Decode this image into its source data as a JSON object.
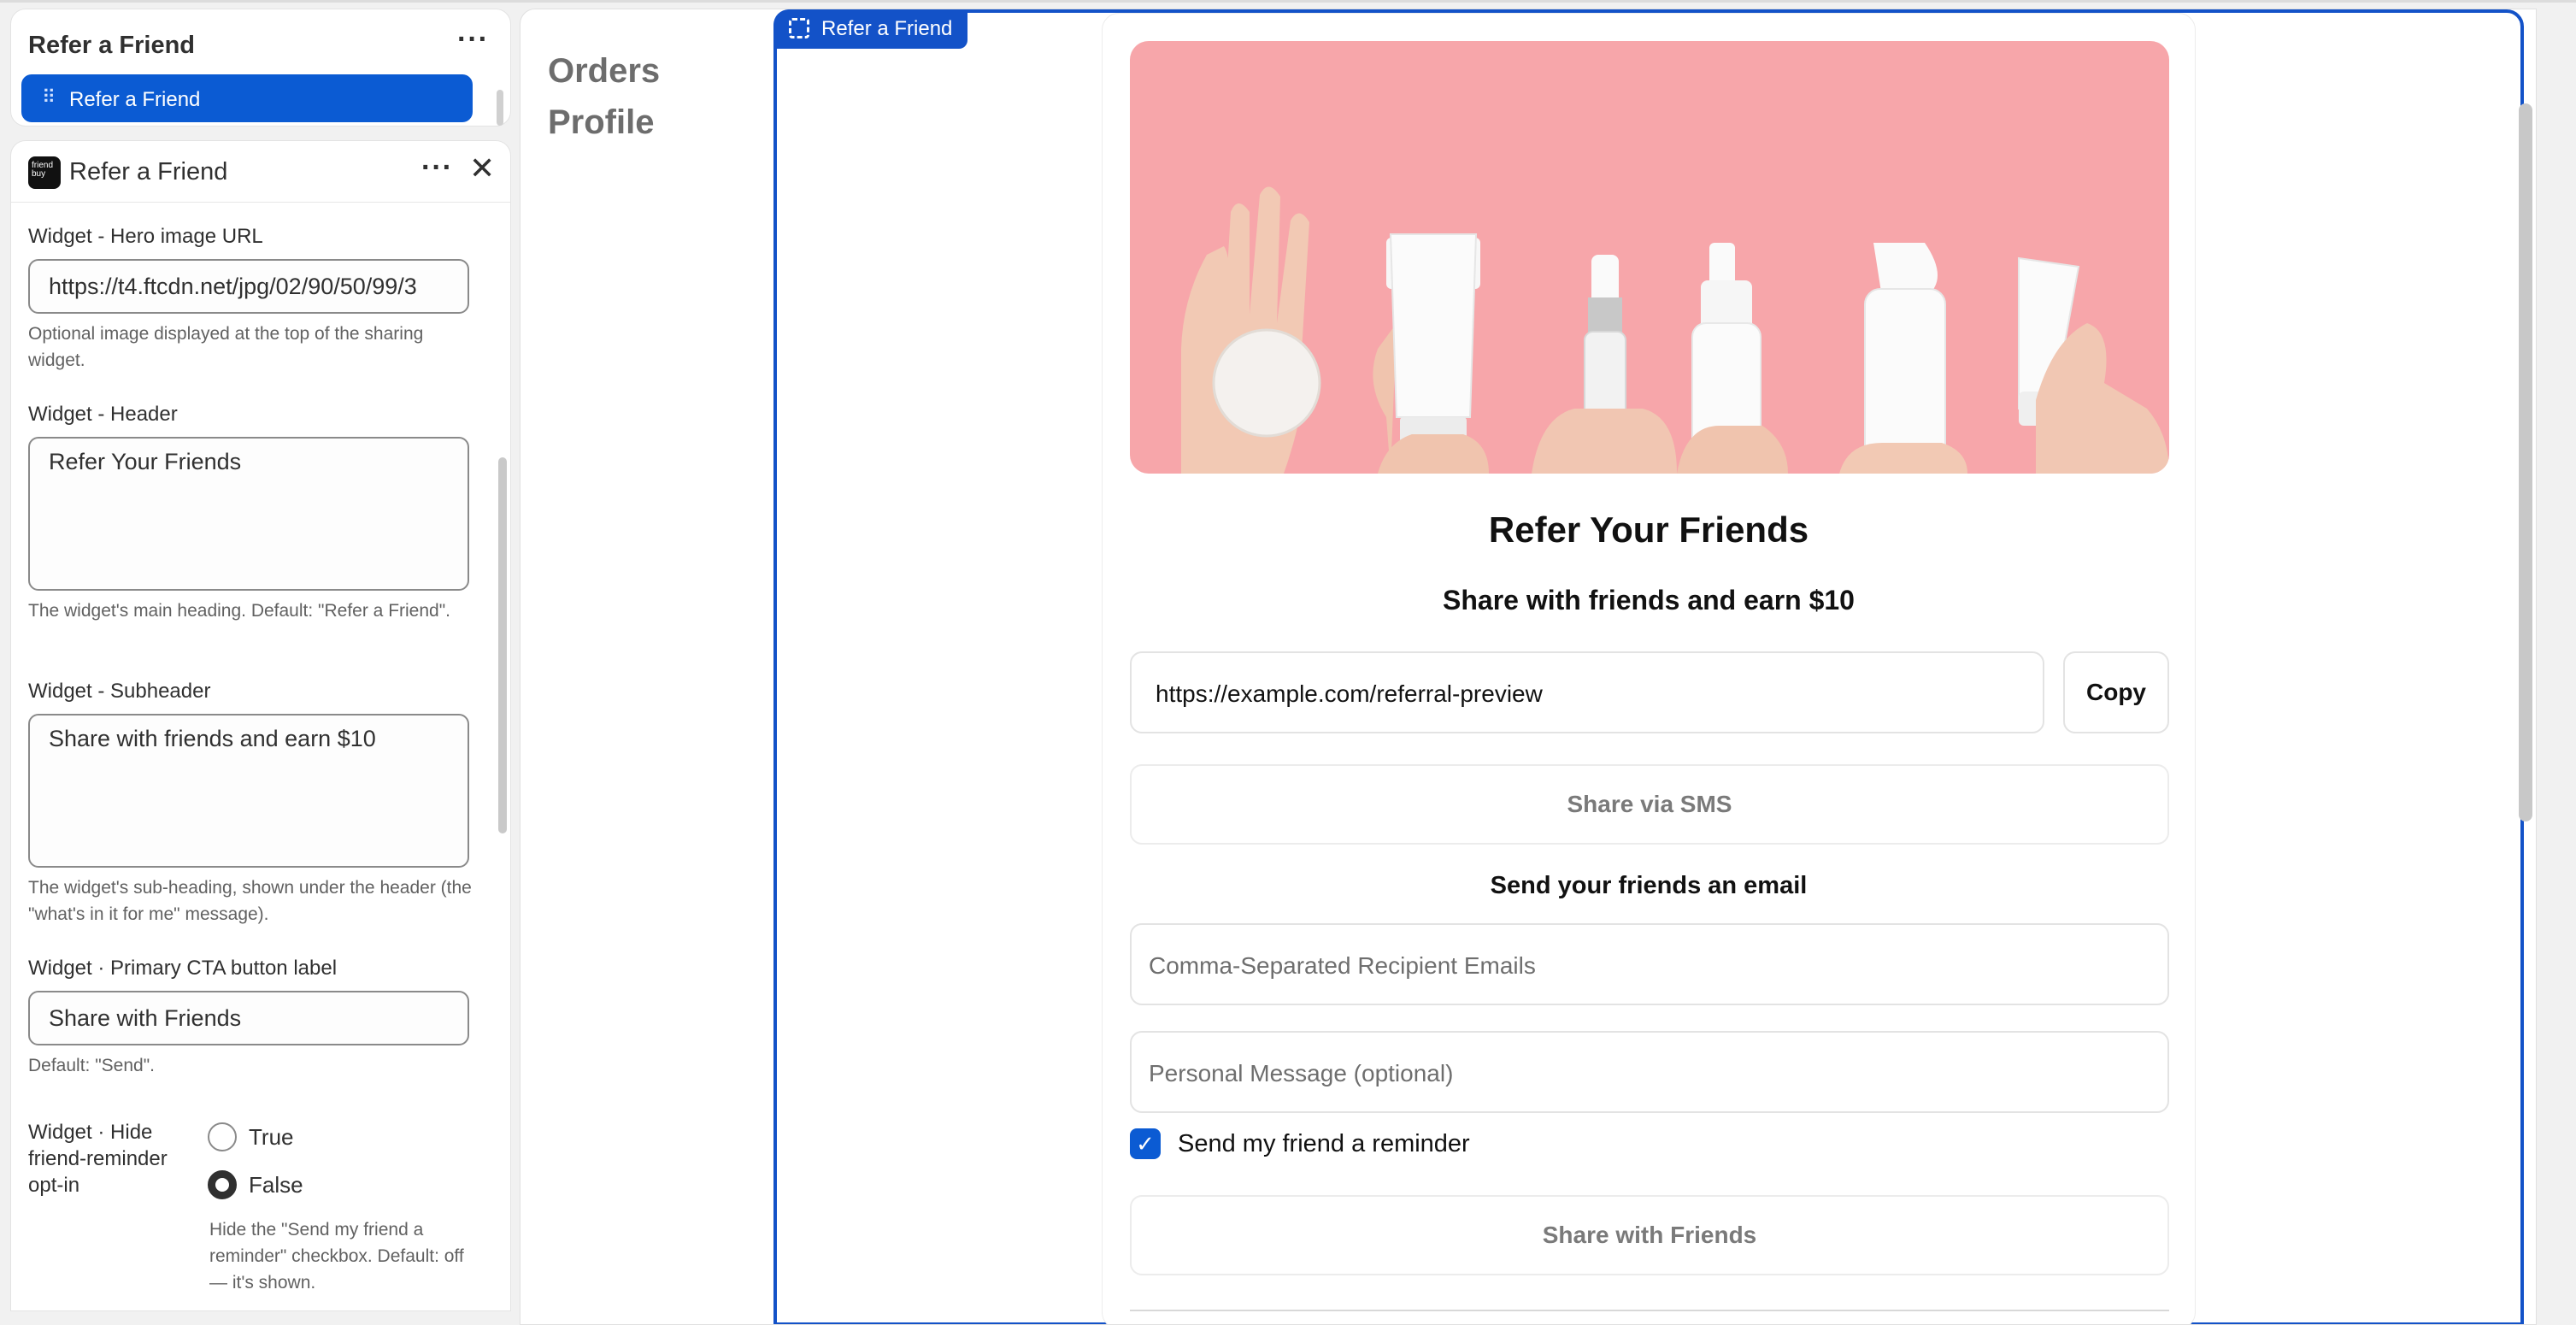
{
  "block_panel": {
    "title": "Refer a Friend",
    "item_label": "Refer a Friend"
  },
  "settings": {
    "title": "Refer a Friend",
    "logo_text": "friend buy",
    "hero_label": "Widget - Hero image URL",
    "hero_value": "https://t4.ftcdn.net/jpg/02/90/50/99/3",
    "hero_help": "Optional image displayed at the top of the sharing widget.",
    "header_label": "Widget - Header",
    "header_value": "Refer Your Friends",
    "header_help": "The widget's main heading. Default: \"Refer a Friend\".",
    "subheader_label": "Widget - Subheader",
    "subheader_value": "Share with friends and earn $10",
    "subheader_help": "The widget's sub-heading, shown under the header (the \"what's in it for me\" message).",
    "cta_label": "Widget · Primary CTA button label",
    "cta_value": "Share with Friends",
    "cta_help": "Default: \"Send\".",
    "hide_label": "Widget · Hide friend-reminder opt-in",
    "opt_true": "True",
    "opt_false": "False",
    "selected_option": "False",
    "hide_help": "Hide the \"Send my friend a reminder\" checkbox. Default: off — it's shown."
  },
  "nav": {
    "orders": "Orders",
    "profile": "Profile"
  },
  "frame_tag": "Refer a Friend",
  "widget": {
    "header": "Refer Your Friends",
    "subheader": "Share with friends and earn $10",
    "referral_url": "https://example.com/referral-preview",
    "copy_label": "Copy",
    "sms_label": "Share via SMS",
    "email_heading": "Send your friends an email",
    "emails_placeholder": "Comma-Separated Recipient Emails",
    "message_placeholder": "Personal Message (optional)",
    "reminder_label": "Send my friend a reminder",
    "reminder_checked": true,
    "cta_label": "Share with Friends"
  },
  "colors": {
    "accent": "#0b5bd3",
    "frame_border": "#1352c8",
    "hero_background": "#f7a6aa"
  }
}
